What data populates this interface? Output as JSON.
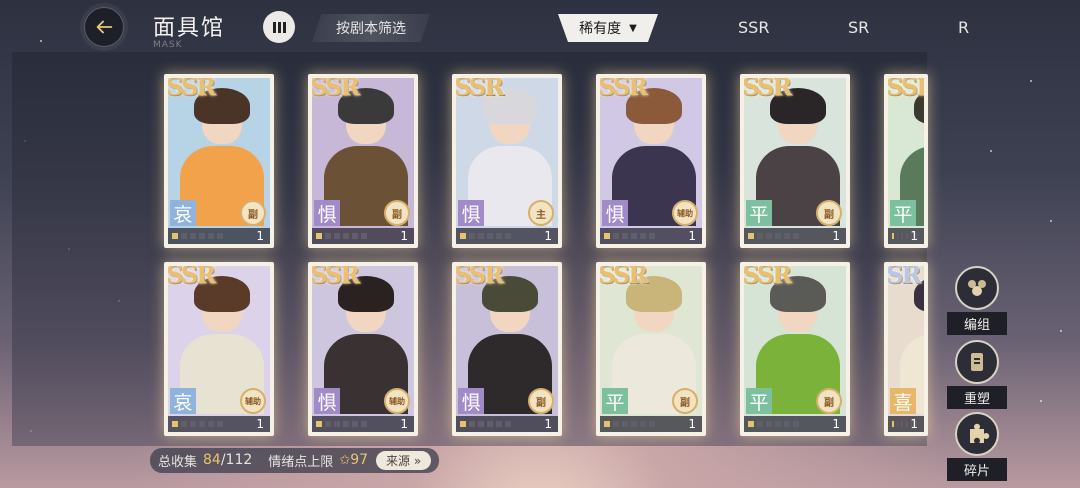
{
  "header": {
    "title": "面具馆",
    "subtitle": "MASK",
    "filter_label": "按剧本筛选"
  },
  "rarity_filter": {
    "selected": "稀有度",
    "tabs": [
      "SSR",
      "SR",
      "R"
    ]
  },
  "cards": [
    {
      "rarity": "SSR",
      "emotion": "哀",
      "role": "副",
      "count": "1",
      "hair": "#4a3428",
      "outfit": "#f2a24a",
      "bg": "#b7d3e6",
      "tag": "#8fb3dd"
    },
    {
      "rarity": "SSR",
      "emotion": "惧",
      "role": "副",
      "count": "1",
      "hair": "#3a3a3a",
      "outfit": "#6b5236",
      "bg": "#c7b8d8",
      "tag": "#a08bc8"
    },
    {
      "rarity": "SSR",
      "emotion": "惧",
      "role": "主",
      "count": "1",
      "hair": "#d8d8dc",
      "outfit": "#e8e8ee",
      "bg": "#cfd8e6",
      "tag": "#a08bc8"
    },
    {
      "rarity": "SSR",
      "emotion": "惧",
      "role": "辅助",
      "count": "1",
      "hair": "#8a5a3a",
      "outfit": "#3b3550",
      "bg": "#d0c8e4",
      "tag": "#a08bc8"
    },
    {
      "rarity": "SSR",
      "emotion": "平",
      "role": "副",
      "count": "1",
      "hair": "#2a2628",
      "outfit": "#4a4244",
      "bg": "#d8e4dc",
      "tag": "#7cc0a0"
    },
    {
      "rarity": "SSR",
      "emotion": "平",
      "role": "",
      "count": "1",
      "hair": "#3a3a30",
      "outfit": "#5a7a5c",
      "bg": "#d9e8d4",
      "tag": "#7cc0a0"
    },
    {
      "rarity": "SSR",
      "emotion": "哀",
      "role": "辅助",
      "count": "1",
      "hair": "#5a3a28",
      "outfit": "#e8e2d2",
      "bg": "#dcd2ea",
      "tag": "#8fb3dd"
    },
    {
      "rarity": "SSR",
      "emotion": "惧",
      "role": "辅助",
      "count": "1",
      "hair": "#2a2220",
      "outfit": "#3a3232",
      "bg": "#cec6de",
      "tag": "#a08bc8"
    },
    {
      "rarity": "SSR",
      "emotion": "惧",
      "role": "副",
      "count": "1",
      "hair": "#4a4a38",
      "outfit": "#2e2a2c",
      "bg": "#c8c0d8",
      "tag": "#a08bc8"
    },
    {
      "rarity": "SSR",
      "emotion": "平",
      "role": "副",
      "count": "1",
      "hair": "#c9b57a",
      "outfit": "#ede8dc",
      "bg": "#dfe6d4",
      "tag": "#7cc0a0"
    },
    {
      "rarity": "SSR",
      "emotion": "平",
      "role": "副",
      "count": "1",
      "hair": "#5a5a56",
      "outfit": "#7bb23a",
      "bg": "#d6e4d6",
      "tag": "#7cc0a0"
    },
    {
      "rarity": "SR",
      "emotion": "喜",
      "role": "",
      "count": "1",
      "hair": "#3a3040",
      "outfit": "#f0e6d4",
      "bg": "#e8dccf",
      "tag": "#e8b86a"
    }
  ],
  "side_actions": {
    "group_label": "编组",
    "reshape_label": "重塑",
    "fragments_label": "碎片"
  },
  "stats": {
    "collection_label": "总收集",
    "collected": "84",
    "total": "/112",
    "mood_label": "情绪点上限",
    "mood_value": "97",
    "source_label": "来源 »"
  },
  "colors": {
    "accent_gold": "#e9c56c",
    "panel_dark": "#1e2029"
  }
}
